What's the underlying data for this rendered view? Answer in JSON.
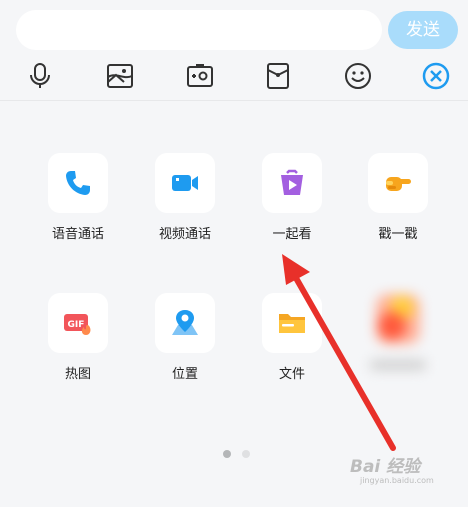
{
  "input": {
    "placeholder": ""
  },
  "send_label": "发送",
  "toolbar_icons": [
    "microphone-icon",
    "image-icon",
    "camera-icon",
    "red-envelope-icon",
    "emoji-icon",
    "close-circle-icon"
  ],
  "grid": {
    "row1": [
      {
        "label": "语音通话",
        "icon": "phone-icon"
      },
      {
        "label": "视频通话",
        "icon": "video-camera-icon"
      },
      {
        "label": "一起看",
        "icon": "watch-together-icon"
      },
      {
        "label": "戳一戳",
        "icon": "poke-hand-icon"
      }
    ],
    "row2": [
      {
        "label": "热图",
        "icon": "gif-icon",
        "badge": "GIF"
      },
      {
        "label": "位置",
        "icon": "location-icon"
      },
      {
        "label": "文件",
        "icon": "folder-icon"
      }
    ]
  },
  "pagination": {
    "current": 1,
    "total": 2
  },
  "watermark": {
    "text": "Bai 经验",
    "sub": "jingyan.baidu.com"
  },
  "colors": {
    "send_bg": "#a9dcfb",
    "accent_blue": "#1e9bf0",
    "arrow_red": "#e8302a"
  }
}
